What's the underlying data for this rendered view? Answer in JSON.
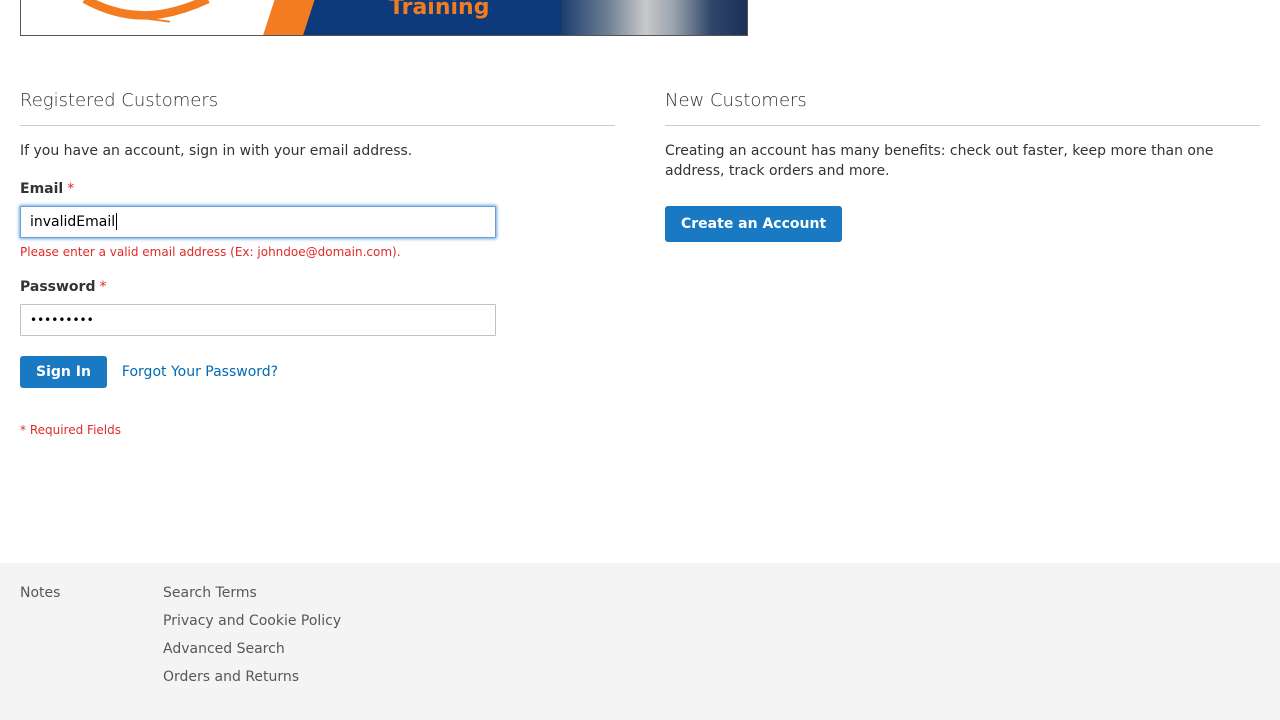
{
  "banner": {
    "text": "Training"
  },
  "registered": {
    "title": "Registered Customers",
    "intro": "If you have an account, sign in with your email address.",
    "email_label": "Email",
    "email_value": "invalidEmail",
    "email_error": "Please enter a valid email address (Ex: johndoe@domain.com).",
    "password_label": "Password",
    "password_value": "•••••••••",
    "required_star": "*",
    "sign_in_label": "Sign In",
    "forgot_label": "Forgot Your Password?",
    "required_note": "* Required Fields"
  },
  "new_customers": {
    "title": "New Customers",
    "intro": "Creating an account has many benefits: check out faster, keep more than one address, track orders and more.",
    "create_label": "Create an Account"
  },
  "footer": {
    "col1": [
      "Notes"
    ],
    "col2": [
      "Search Terms",
      "Privacy and Cookie Policy",
      "Advanced Search",
      "Orders and Returns"
    ]
  },
  "colors": {
    "primary": "#1979c3",
    "link": "#006bb4",
    "error": "#e02b27",
    "footer_bg": "#f4f4f4"
  }
}
